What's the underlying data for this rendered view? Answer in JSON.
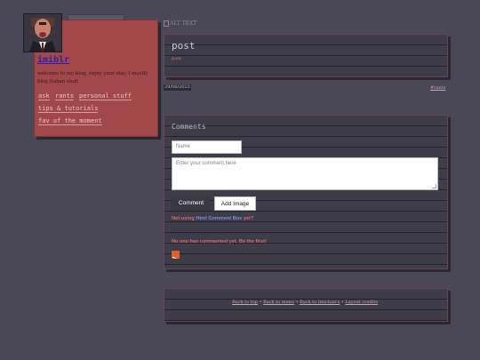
{
  "sidebar": {
    "blog_title": "imiblr",
    "description": "welcome to my blog, enjoy your stay. I mostly blog Italian stuff.",
    "nav": [
      "ask",
      "rants",
      "personal stuff",
      "tips & tutorials",
      "fav of the moment"
    ]
  },
  "post": {
    "image_alt": "ALT TEXT",
    "title": "post",
    "body": "post",
    "date": "29/06/2023",
    "tag": "#rants"
  },
  "comments": {
    "heading": "Comments",
    "name_placeholder": "Name",
    "comment_placeholder": "Enter your comment here",
    "comment_button": "Comment",
    "add_image_button": "Add Image",
    "not_using_prefix": "Not using",
    "not_using_link": "Html Comment Box",
    "not_using_suffix": "yet?",
    "empty_message": "No one has commented yet. Be the first!"
  },
  "footer": {
    "links": [
      "Back to top",
      "Back to menu",
      "Back to Imichan's",
      "Layout credits"
    ],
    "separator": "•"
  },
  "icons": [
    "avatar",
    "rss-icon",
    "broken-image-icon"
  ],
  "colors": {
    "background": "#4a4757",
    "sidebar": "#a2484a",
    "panel": "#3f3c4a",
    "accent_text": "#d46a6a",
    "link_blue": "#7f8fe0"
  }
}
